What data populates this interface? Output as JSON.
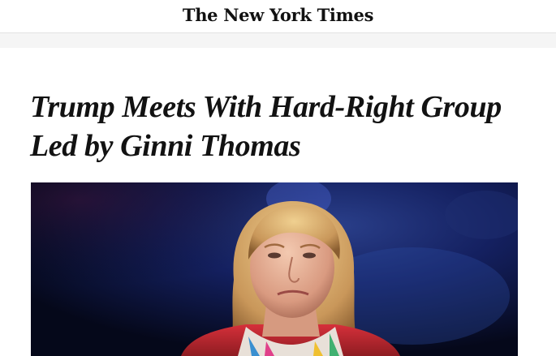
{
  "masthead": {
    "logo_text": "The New York Times"
  },
  "article": {
    "headline": "Trump Meets With Hard-Right Group Led by Ginni Thomas"
  },
  "hero_image": {
    "subject": "woman-portrait-photo",
    "background_color": "#0a0f2a",
    "jacket_color": "#c4282f"
  },
  "colors": {
    "headline_text": "#121212",
    "page_background": "#ffffff",
    "divider": "#e2e2e2"
  }
}
